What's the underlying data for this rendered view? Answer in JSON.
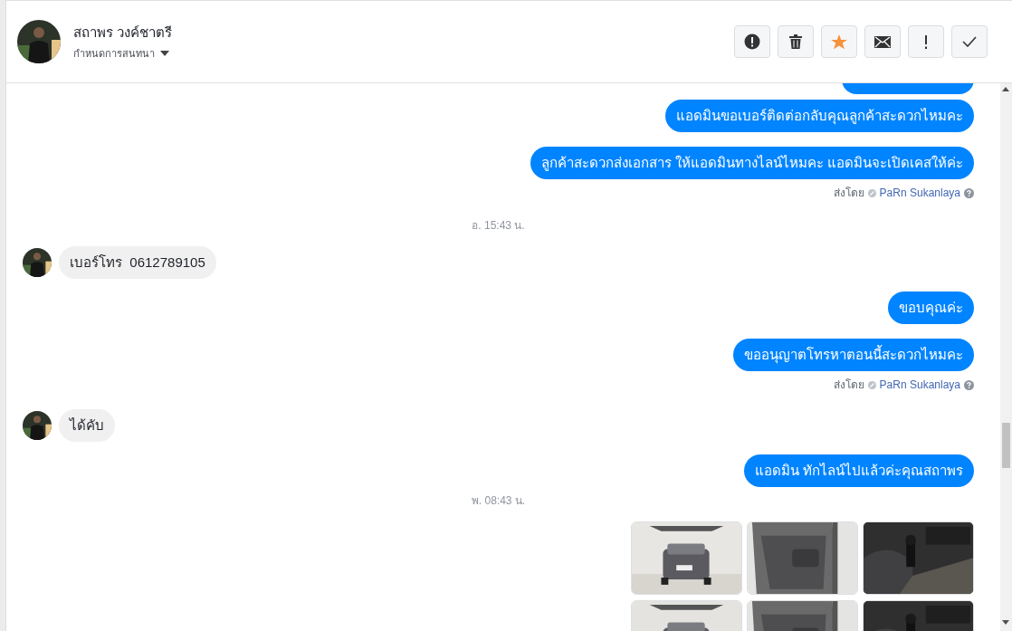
{
  "header": {
    "name": "สถาพร วงค์ชาตรี",
    "subtitle": "กำหนดการสนทนา",
    "buttons": [
      {
        "kind": "alert"
      },
      {
        "kind": "trash"
      },
      {
        "kind": "star"
      },
      {
        "kind": "mail"
      },
      {
        "kind": "exclaim"
      },
      {
        "kind": "check"
      }
    ]
  },
  "messages": [
    {
      "kind": "out_cut"
    },
    {
      "kind": "out",
      "text": "แอดมินขอเบอร์ติดต่อกลับคุณลูกค้าสะดวกไหมคะ"
    },
    {
      "kind": "out",
      "text": "ลูกค้าสะดวกส่งเอกสาร ให้แอดมินทางไลน์ไหมคะ แอดมินจะเปิดเคสให้ค่ะ"
    },
    {
      "kind": "sent_by",
      "label": "ส่งโดย",
      "name": "PaRn Sukanlaya"
    },
    {
      "kind": "time",
      "text": "อ. 15:43 น."
    },
    {
      "kind": "in",
      "text": "เบอร์โทร  0612789105"
    },
    {
      "kind": "out",
      "text": "ขอบคุณค่ะ"
    },
    {
      "kind": "out",
      "text": "ขออนุญาตโทรหาตอนนี้สะดวกไหมคะ"
    },
    {
      "kind": "sent_by",
      "label": "ส่งโดย",
      "name": "PaRn Sukanlaya"
    },
    {
      "kind": "in",
      "text": "ได้คับ"
    },
    {
      "kind": "out",
      "text": "แอดมิน ทักไลน์ไปแล้วค่ะคุณสถาพร"
    },
    {
      "kind": "time",
      "text": "พ. 08:43 น."
    },
    {
      "kind": "images"
    }
  ]
}
